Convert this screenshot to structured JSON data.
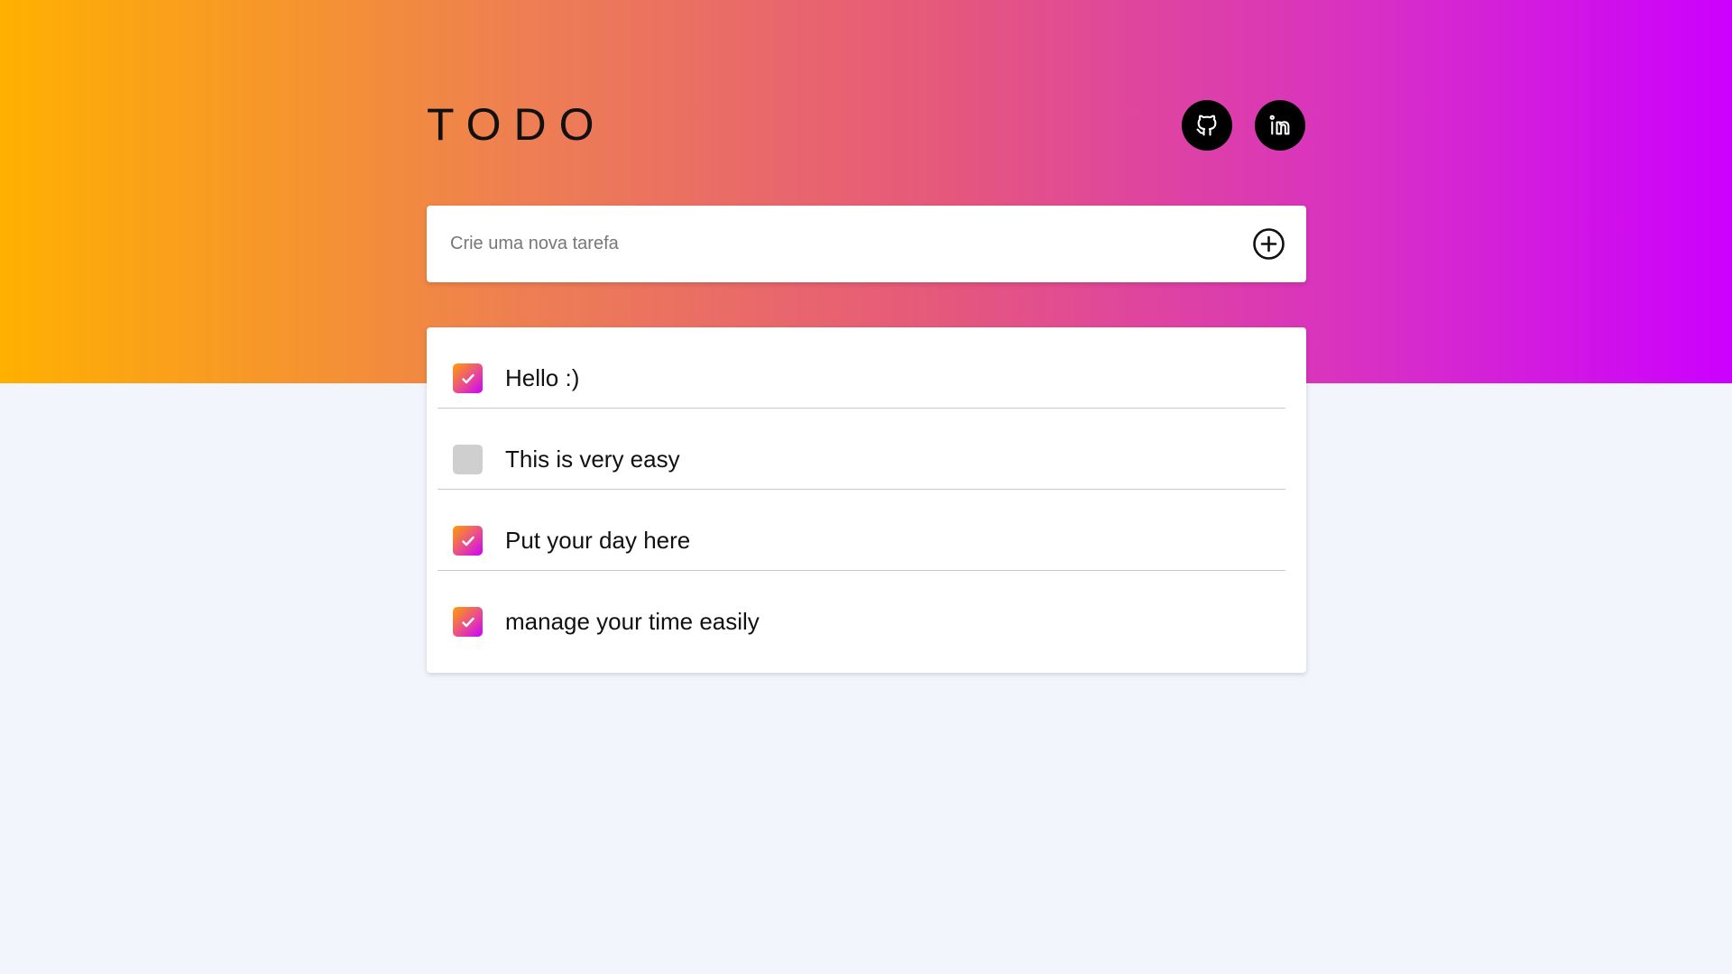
{
  "header": {
    "title": "TODO"
  },
  "social": [
    {
      "name": "github-icon"
    },
    {
      "name": "linkedin-icon"
    }
  ],
  "new_task": {
    "placeholder": "Crie uma nova tarefa",
    "value": ""
  },
  "colors": {
    "gradient_start": "#ffb000",
    "gradient_end": "#cc00ff",
    "background": "#f2f5fc",
    "unchecked": "#cfcfcf"
  },
  "tasks": [
    {
      "label": "Hello :)",
      "done": true
    },
    {
      "label": "This is very easy",
      "done": false
    },
    {
      "label": "Put your day here",
      "done": true
    },
    {
      "label": "manage your time easily",
      "done": true
    }
  ]
}
